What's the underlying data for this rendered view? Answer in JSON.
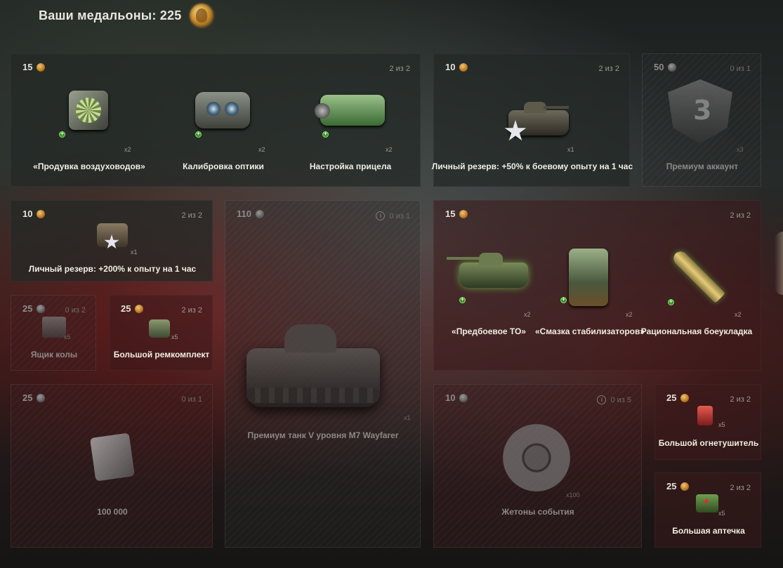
{
  "header": {
    "title": "Ваши медальоны: 225",
    "medal_icon": "medallion-icon"
  },
  "cards": {
    "equip1": {
      "price": "15",
      "count": "2 из 2",
      "items": [
        {
          "label": "«Продувка воздуховодов»",
          "qty": "x2"
        },
        {
          "label": "Калибровка оптики",
          "qty": "x2"
        },
        {
          "label": "Настройка прицела",
          "qty": "x2"
        }
      ]
    },
    "reserve50": {
      "price": "10",
      "count": "2 из 2",
      "label": "Личный резерв: +50% к боевому опыту на 1 час",
      "qty": "x1"
    },
    "premium": {
      "price": "50",
      "count": "0 из 1",
      "label": "Премиум аккаунт",
      "qty": "x3",
      "emblem_digit": "3"
    },
    "reserve200": {
      "price": "10",
      "count": "2 из 2",
      "label": "Личный резерв: +200% к опыту на 1 час",
      "qty": "x1"
    },
    "tank": {
      "price": "110",
      "count": "0 из 1",
      "label": "Премиум танк V уровня M7 Wayfarer",
      "qty": "x1"
    },
    "equip2": {
      "price": "15",
      "count": "2 из 2",
      "items": [
        {
          "label": "«Предбоевое ТО»",
          "qty": "x2"
        },
        {
          "label": "«Смазка стабилизаторов»",
          "qty": "x2"
        },
        {
          "label": "Рациональная боеукладка",
          "qty": "x2"
        }
      ]
    },
    "cola": {
      "price": "25",
      "count": "0 из 2",
      "label": "Ящик колы",
      "qty": "x5"
    },
    "repair": {
      "price": "25",
      "count": "2 из 2",
      "label": "Большой ремкомплект",
      "qty": "x5"
    },
    "silver": {
      "price": "25",
      "count": "0 из 1",
      "label": "100 000"
    },
    "tokens": {
      "price": "10",
      "count": "0 из 5",
      "label": "Жетоны события",
      "qty": "x100"
    },
    "extinguisher": {
      "price": "25",
      "count": "2 из 2",
      "label": "Большой огнетушитель",
      "qty": "x5"
    },
    "medkit": {
      "price": "25",
      "count": "2 из 2",
      "label": "Большая аптечка",
      "qty": "x5"
    }
  }
}
